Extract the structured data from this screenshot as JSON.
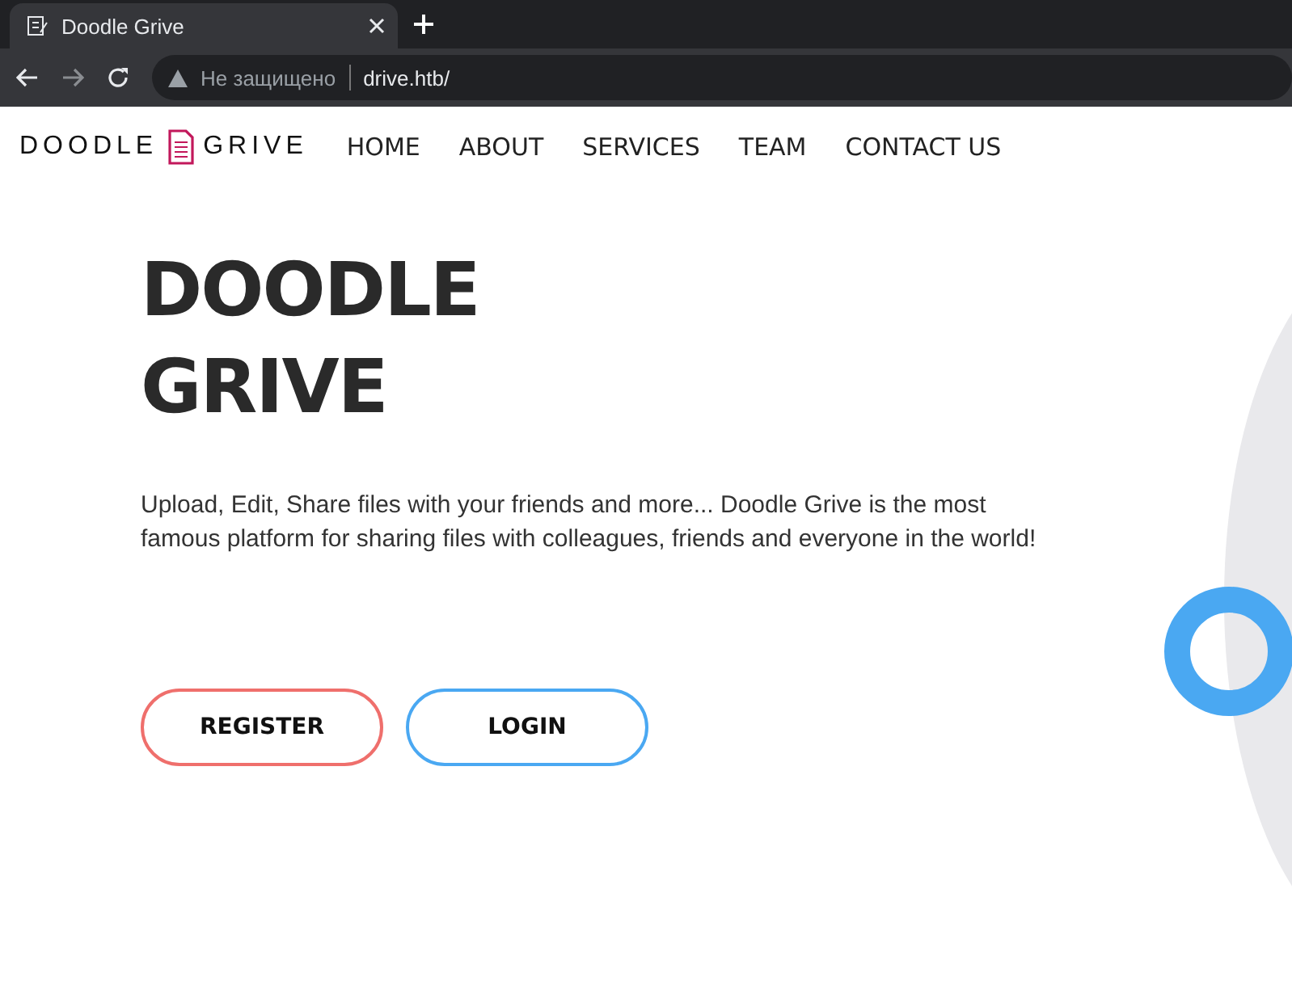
{
  "browser": {
    "tab": {
      "title": "Doodle Grive"
    },
    "security": "Не защищено",
    "url": "drive.htb/"
  },
  "logo": {
    "left": "DOODLE",
    "right": "GRIVE"
  },
  "nav": [
    "HOME",
    "ABOUT",
    "SERVICES",
    "TEAM",
    "CONTACT US"
  ],
  "hero": {
    "title_lines": [
      "DOODLE",
      "GRIVE"
    ],
    "text": "Upload, Edit, Share files with your friends and more... Doodle Grive is the most famous platform for sharing files with colleagues, friends and everyone in the world!",
    "buttons": [
      {
        "label": "REGISTER",
        "kind": "register"
      },
      {
        "label": "LOGIN",
        "kind": "login"
      }
    ]
  }
}
